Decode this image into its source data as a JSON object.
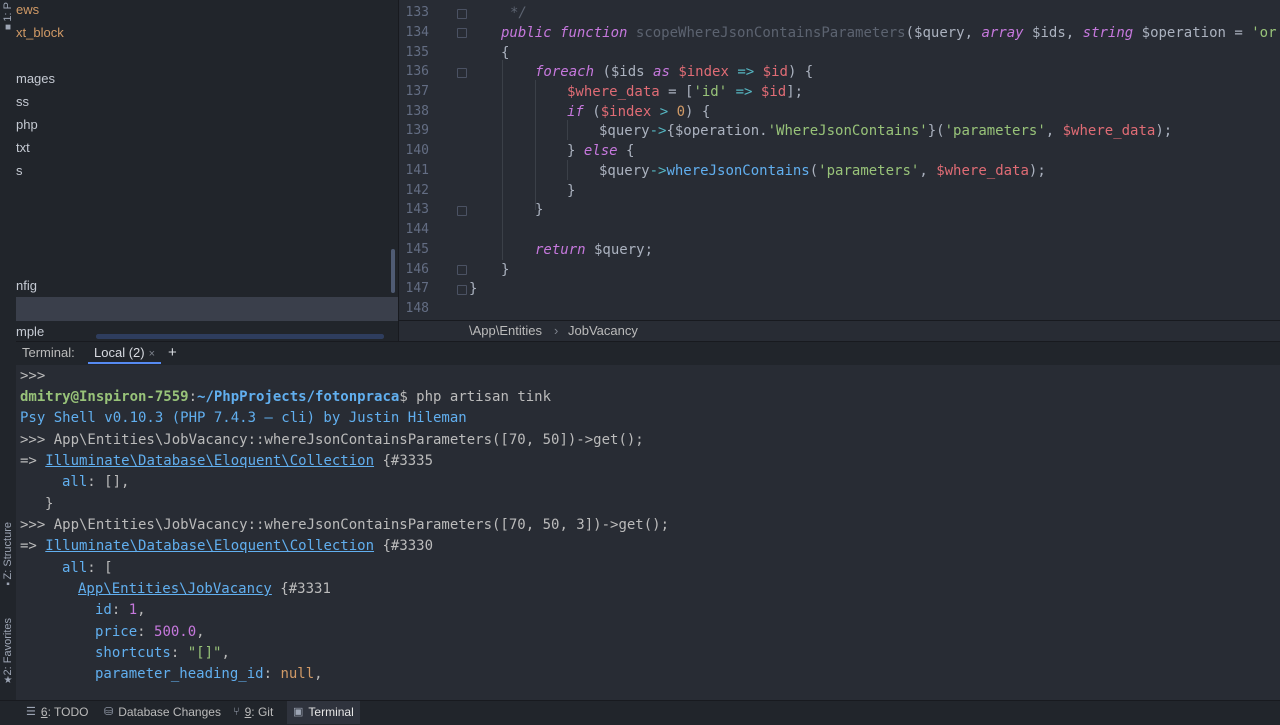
{
  "left_strip": {
    "project_tab": "1: P",
    "structure_tab": "Z: Structure",
    "favorites_tab": "2: Favorites"
  },
  "project_tree": {
    "items": [
      {
        "label": "ews",
        "modified": true
      },
      {
        "label": "xt_block",
        "modified": true
      },
      {
        "label": "mages",
        "modified": false
      },
      {
        "label": "ss",
        "modified": false
      },
      {
        "label": "php",
        "modified": false
      },
      {
        "label": "txt",
        "modified": false
      },
      {
        "label": "s",
        "modified": false
      },
      {
        "label": "nfig",
        "modified": false
      },
      {
        "label": "mple",
        "modified": false
      }
    ]
  },
  "editor": {
    "line_numbers": [
      "133",
      "134",
      "135",
      "136",
      "137",
      "138",
      "139",
      "140",
      "141",
      "142",
      "143",
      "144",
      "145",
      "146",
      "147",
      "148"
    ],
    "code": {
      "l133": "*/",
      "l134_kw1": "public",
      "l134_kw2": "function",
      "l134_name": "scopeWhereJsonContainsParameters",
      "l134_rest1": "($query, ",
      "l134_kw3": "array",
      "l134_rest2": " $ids, ",
      "l134_kw4": "string",
      "l134_rest3": " $operation = ",
      "l134_str": "'or'",
      "l134_rest4": ")",
      "l135": "{",
      "l136_kw": "foreach",
      "l136_a": " ($ids ",
      "l136_as": "as",
      "l136_var1": "$index",
      "l136_op": "=>",
      "l136_var2": "$id",
      "l136_b": ") {",
      "l137_var": "$where_data",
      "l137_a": " = [",
      "l137_str": "'id'",
      "l137_op": "=>",
      "l137_var2": "$id",
      "l137_b": "];",
      "l138_kw": "if",
      "l138_a": " (",
      "l138_var": "$index",
      "l138_op": ">",
      "l138_num": "0",
      "l138_b": ") {",
      "l139_a": "$query",
      "l139_op": "->",
      "l139_b": "{$operation.",
      "l139_str": "'WhereJsonContains'",
      "l139_c": "}(",
      "l139_str2": "'parameters'",
      "l139_d": ", ",
      "l139_var": "$where_data",
      "l139_e": ");",
      "l140_a": "} ",
      "l140_kw": "else",
      "l140_b": " {",
      "l141_a": "$query",
      "l141_op": "->",
      "l141_fn": "whereJsonContains",
      "l141_b": "(",
      "l141_str": "'parameters'",
      "l141_c": ", ",
      "l141_var": "$where_data",
      "l141_d": ");",
      "l142": "}",
      "l143": "}",
      "l145_kw": "return",
      "l145_rest": " $query;",
      "l146": "}",
      "l147": "}"
    },
    "breadcrumb": [
      "\\App\\Entities",
      "JobVacancy"
    ],
    "breadcrumb_sep": "›"
  },
  "terminal": {
    "label": "Terminal:",
    "tab": "Local (2)",
    "tab_close": "×",
    "add": "+",
    "lines": {
      "t1": ">>>",
      "t2_user": "dmitry@Inspiron-7559",
      "t2_colon": ":",
      "t2_path": "~/PhpProjects/fotonpraca",
      "t2_cmd": "$ php artisan tink",
      "t3": "Psy Shell v0.10.3 (PHP 7.4.3 — cli) by Justin Hileman",
      "t4": ">>> App\\Entities\\JobVacancy::whereJsonContainsParameters([70, 50])->get();",
      "t5_arrow": "=> ",
      "t5_link": "Illuminate\\Database\\Eloquent\\Collection",
      "t5_rest": " {#3335",
      "t6_key": "all",
      "t6_rest": ": [],",
      "t7": "}",
      "t8": ">>> App\\Entities\\JobVacancy::whereJsonContainsParameters([70, 50, 3])->get();",
      "t9_arrow": "=> ",
      "t9_link": "Illuminate\\Database\\Eloquent\\Collection",
      "t9_rest": " {#3330",
      "t10_key": "all",
      "t10_rest": ": [",
      "t11_link": "App\\Entities\\JobVacancy",
      "t11_rest": " {#3331",
      "t12_key": "id",
      "t12_sep": ": ",
      "t12_val": "1",
      "t12_end": ",",
      "t13_key": "price",
      "t13_sep": ": ",
      "t13_val": "500.0",
      "t13_end": ",",
      "t14_key": "shortcuts",
      "t14_sep": ": ",
      "t14_val": "\"[]\"",
      "t14_end": ",",
      "t15_key": "parameter_heading_id",
      "t15_sep": ": ",
      "t15_val": "null",
      "t15_end": ","
    }
  },
  "statusbar": {
    "todo_num": "6",
    "todo_label": ": TODO",
    "db_label": "Database Changes",
    "git_num": "9",
    "git_label": ": Git",
    "terminal_label": "Terminal"
  }
}
